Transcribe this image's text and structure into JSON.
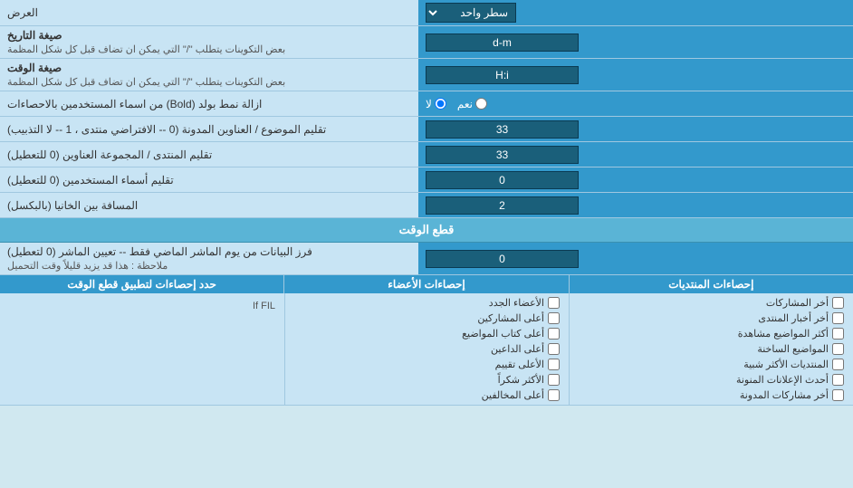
{
  "rows": [
    {
      "id": "row-1",
      "right_label": "العرض",
      "left_type": "select",
      "left_value": "سطر واحد"
    },
    {
      "id": "row-2",
      "right_label": "صيغة التاريخ\nبعض التكوينات يتطلب \"/\" التي يمكن ان تضاف قبل كل شكل المظمة",
      "right_label_line1": "صيغة التاريخ",
      "right_label_line2": "بعض التكوينات يتطلب \"/\" التي يمكن ان تضاف قبل كل شكل المظمة",
      "left_type": "input",
      "left_value": "d-m"
    },
    {
      "id": "row-3",
      "right_label_line1": "صيغة الوقت",
      "right_label_line2": "بعض التكوينات يتطلب \"/\" التي يمكن ان تضاف قبل كل شكل المظمة",
      "left_type": "input",
      "left_value": "H:i"
    },
    {
      "id": "row-4",
      "right_label": "ازالة نمط بولد (Bold) من اسماء المستخدمين بالاحصاءات",
      "left_type": "radio",
      "radio_yes": "نعم",
      "radio_no": "لا",
      "radio_selected": "no"
    },
    {
      "id": "row-5",
      "right_label": "تقليم الموضوع / العناوين المدونة (0 -- الافتراضي منتدى ، 1 -- لا التذبيب)",
      "left_type": "input",
      "left_value": "33"
    },
    {
      "id": "row-6",
      "right_label": "تقليم المنتدى / المجموعة العناوين (0 للتعطيل)",
      "left_type": "input",
      "left_value": "33"
    },
    {
      "id": "row-7",
      "right_label": "تقليم أسماء المستخدمين (0 للتعطيل)",
      "left_type": "input",
      "left_value": "0"
    },
    {
      "id": "row-8",
      "right_label": "المسافة بين الخانيا (بالبكسل)",
      "left_type": "input",
      "left_value": "2"
    }
  ],
  "section_header": "قطع الوقت",
  "row_cutoff": {
    "right_label_line1": "فرز البيانات من يوم الماشر الماضي فقط -- تعيين الماشر (0 لتعطيل)",
    "right_label_line2": "ملاحظة : هذا قد يزيد قليلاً وقت التحميل",
    "left_value": "0"
  },
  "stats_header": "حدد إحصاءات لتطبيق قطع الوقت",
  "stats_col1_header": "إحصاءات المنتديات",
  "stats_col1_items": [
    "أخر المشاركات",
    "أخر أخبار المنتدى",
    "أكثر المواضيع مشاهدة",
    "المواضيع الساخنة",
    "المنتديات الأكثر شبية",
    "أحدث الإعلانات المنونة",
    "أخر مشاركات المدونة"
  ],
  "stats_col2_header": "إحصاءات الأعضاء",
  "stats_col2_items": [
    "الأعضاء الجدد",
    "أعلى المشاركين",
    "أعلى كتاب المواضيع",
    "أعلى الداعين",
    "الأعلى تقييم",
    "الأكثر شكراً",
    "أعلى المخالفين"
  ],
  "checkboxes_note": "If FIL"
}
